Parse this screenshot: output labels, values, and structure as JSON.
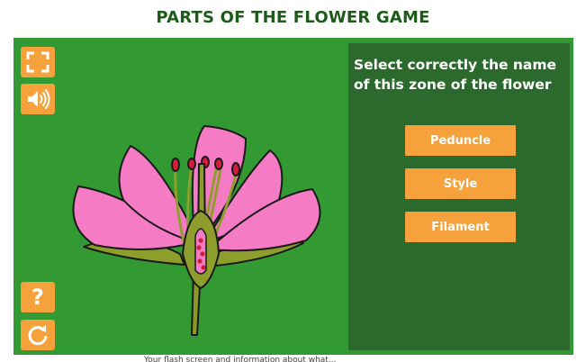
{
  "game": {
    "title": "PARTS OF THE FLOWER GAME",
    "prompt": "Select correctly the name of this zone of the flower",
    "options": [
      "Peduncle",
      "Style",
      "Filament"
    ],
    "caption": "Your flash screen and information about what..."
  },
  "controls": {
    "fullscreen": "fullscreen-icon",
    "sound": "speaker-icon",
    "help": "?",
    "restart": "restart-icon"
  },
  "colors": {
    "stage": "#339933",
    "panel": "#2b6a2c",
    "button": "#f5a23c",
    "title": "#1e5b1a",
    "petal": "#f47bc4"
  }
}
